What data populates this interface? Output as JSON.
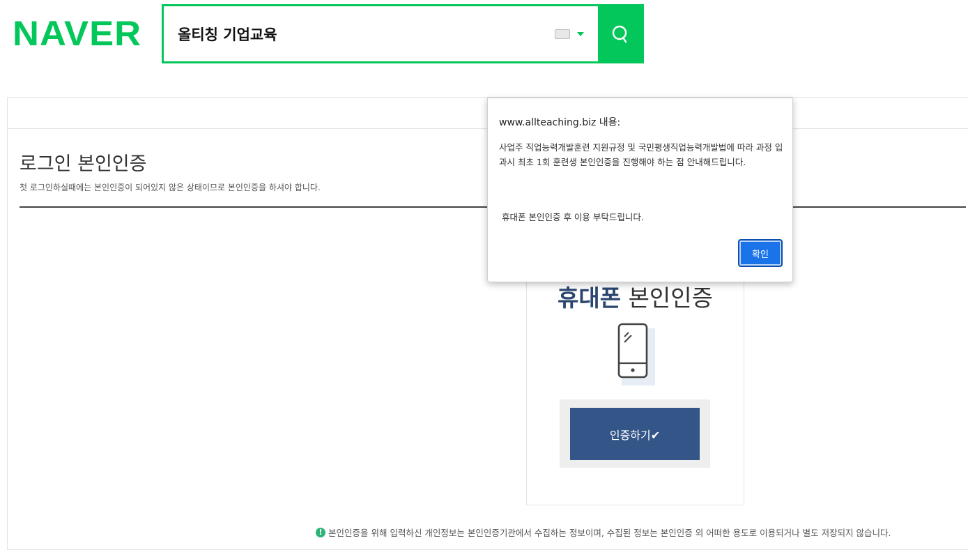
{
  "header": {
    "logo": "NAVER",
    "search_value": "올티칭 기업교육",
    "icons": {
      "keyboard": "keyboard-icon",
      "search": "search-icon"
    },
    "brand_color": "#03c75a"
  },
  "page": {
    "title": "로그인 본인인증",
    "subtitle": "첫 로그인하실때에는 본인인증이 되어있지 않은 상태이므로 본인인증을 하셔야 합니다."
  },
  "cert": {
    "title_strong": "휴대폰",
    "title_rest": " 본인인증",
    "button_label": "인증하기✔",
    "icon": "smartphone-icon",
    "button_color": "#335588"
  },
  "footnote": {
    "icon": "info-icon",
    "text": "본인인증을 위해 입력하신 개인정보는 본인인증기관에서 수집하는 정보이며, 수집된 정보는 본인인증 외 어떠한 용도로 이용되거나 별도 저장되지 않습니다."
  },
  "dialog": {
    "origin": "www.allteaching.biz 내용:",
    "message": "사업주 직업능력개발훈련 지원규정 및 국민평생직업능력개발법에 따라 과정 입과시 최초 1회 훈련생 본인인증을 진행해야 하는 점 안내해드립니다.",
    "message2": "휴대폰 본인인증 후 이용 부탁드립니다.",
    "ok_label": "확인",
    "ok_color": "#1a73e8"
  }
}
